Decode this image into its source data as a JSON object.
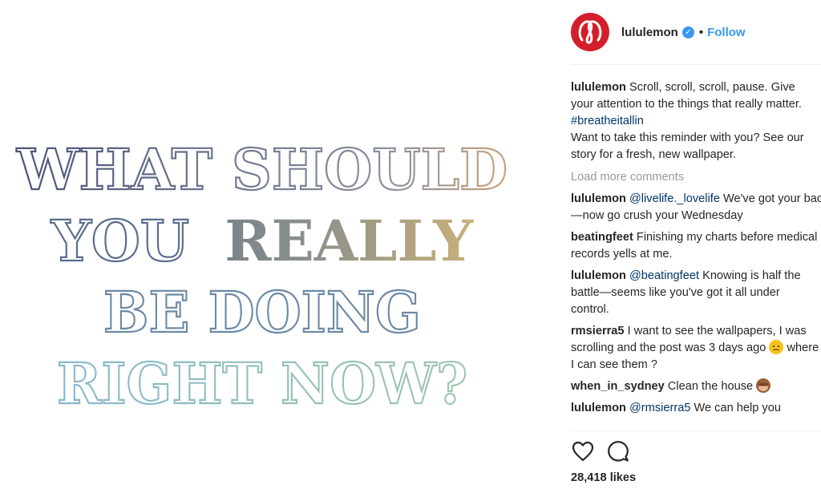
{
  "image": {
    "lines": [
      "WHAT SHOULD",
      "YOU",
      "REALLY",
      "BE DOING",
      "RIGHT NOW?"
    ],
    "colors": {
      "line1_start": "#4a5478",
      "line1_end": "#c9a27a",
      "really_start": "#5b6b86",
      "really_end": "#c9b07a",
      "line3": "#6b89a6",
      "line4_start": "#88b8cf",
      "line4_end": "#9fc6ad"
    }
  },
  "header": {
    "username": "lululemon",
    "verified_icon": "verified-badge-icon",
    "separator": "•",
    "follow_label": "Follow"
  },
  "caption": {
    "username": "lululemon",
    "text1": " Scroll, scroll, scroll, pause. Give your attention to the things that really matter. ",
    "hashtag": "#breatheitallin",
    "text2": "Want to take this reminder with you? See our story for a fresh, new wallpaper."
  },
  "load_more": "Load more comments",
  "comments": [
    {
      "username": "lululemon",
      "mention": "@livelife._lovelife",
      "text": " We've got your back—now go crush your Wednesday"
    },
    {
      "username": "beatingfeet",
      "mention": "",
      "text": " Finishing my charts before medical records yells at me."
    },
    {
      "username": "lululemon",
      "mention": "@beatingfeet",
      "text": " Knowing is half the battle—seems like you've got it all under control."
    },
    {
      "username": "rmsierra5",
      "mention": "",
      "text": " I want to see the wallpapers, I was scrolling and the post was 3 days ago",
      "text_after_emoji": " where I can see them ?"
    },
    {
      "username": "when_in_sydney",
      "mention": "",
      "text": " Clean the house"
    },
    {
      "username": "lululemon",
      "mention": "@rmsierra5",
      "text": " We can help you"
    }
  ],
  "likes": "28,418 likes",
  "icons": {
    "like": "heart-icon",
    "comment": "comment-icon",
    "sad_emoji": "disappointed-face-icon",
    "monkey_emoji": "see-no-evil-monkey-icon"
  }
}
